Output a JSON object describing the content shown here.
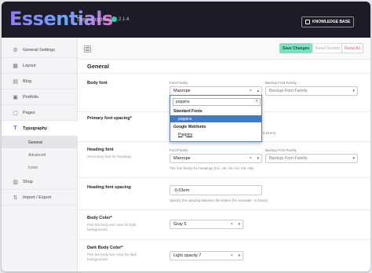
{
  "header": {
    "logo": "Essentials",
    "subtitle": "Theme options",
    "version": "2.1.4",
    "knowledge_base": "KNOWLEDGE BASE"
  },
  "sidebar": {
    "items": [
      {
        "label": "General Settings",
        "icon": "gear-icon"
      },
      {
        "label": "Layout",
        "icon": "layout-icon"
      },
      {
        "label": "Blog",
        "icon": "blog-icon"
      },
      {
        "label": "Portfolio",
        "icon": "portfolio-icon"
      },
      {
        "label": "Pages",
        "icon": "pages-icon"
      },
      {
        "label": "Typography",
        "icon": "typography-icon"
      },
      {
        "label": "Shop",
        "icon": "shop-icon"
      },
      {
        "label": "Import / Export",
        "icon": "import-export-icon"
      }
    ],
    "sub_items": [
      "General",
      "Advanced",
      "Icons"
    ]
  },
  "toolbar": {
    "save": "Save Changes",
    "reset_section": "Reset Section",
    "reset_all": "Reset All"
  },
  "section": {
    "title": "General"
  },
  "fields": {
    "body_font": {
      "label": "Body font",
      "family_label": "Font Family",
      "family_value": "Manrope",
      "backup_label": "Backup Font Family",
      "backup_placeholder": "Backup Font Family"
    },
    "primary_spacing": {
      "label": "Primary font spacing*",
      "hint_partial": "0.01em)"
    },
    "heading_font": {
      "label": "Heading font",
      "desc": "Secondary font for headings",
      "family_label": "Font Family",
      "family_value": "Manrope",
      "backup_label": "Backup Font Family",
      "backup_placeholder": "Backup Font Family",
      "hint": "The font family for headings (H1, H2, H3, H4, H5, H6)."
    },
    "heading_spacing": {
      "label": "Heading font spacing",
      "value": "-0.03em",
      "hint": "Specify the spacing between the letters (for example: -0.01em)"
    },
    "body_color": {
      "label": "Body Color*",
      "desc": "Pick the body text color for light backgrounds.",
      "value": "Gray 5"
    },
    "dark_body_color": {
      "label": "Dark Body Color*",
      "desc": "Pick the body text color for dark backgrounds.",
      "value": "Light opacity 7"
    }
  },
  "dropdown": {
    "search_value": "poppins",
    "group_standard": "Standard Fonts",
    "standard_option": "poppins",
    "group_google": "Google Webfonts",
    "google_option": "Poppins"
  }
}
